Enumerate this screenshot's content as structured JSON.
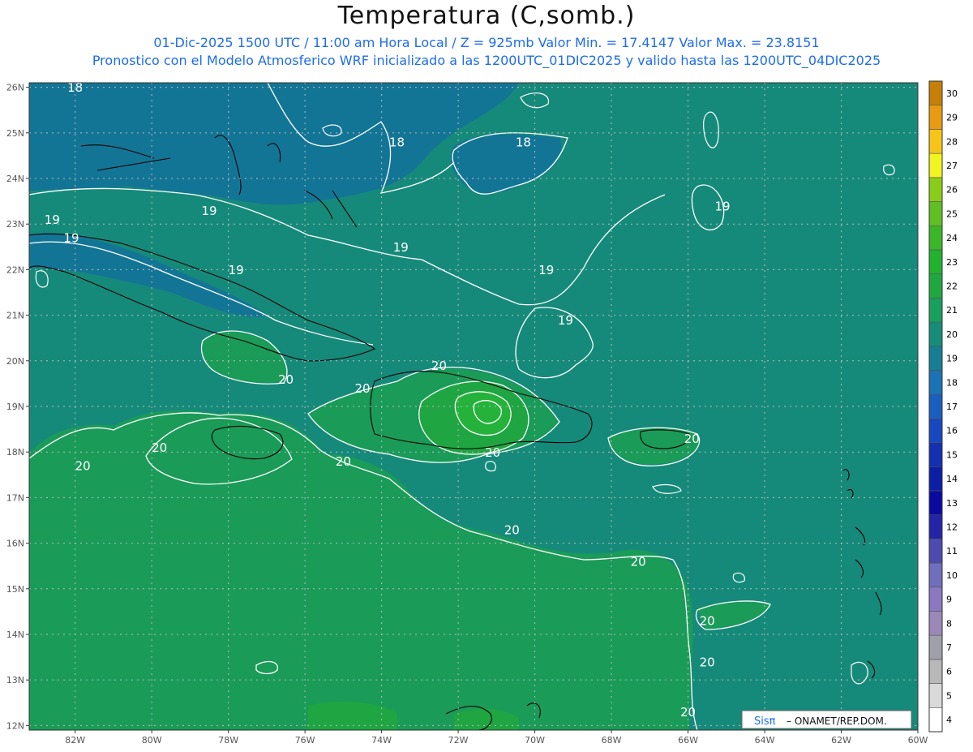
{
  "header": {
    "title": "Temperatura (C,somb.)",
    "line1": "01-Dic-2025  1500 UTC / 11:00 am Hora Local / Z = 925mb   Valor Min. = 17.4147  Valor Max. = 23.8151",
    "line2": "Pronostico con el Modelo Atmosferico WRF inicializado a las 1200UTC_01DIC2025 y valido hasta las  1200UTC_04DIC2025"
  },
  "map": {
    "lon_range": [
      -83.2,
      -60
    ],
    "lat_range": [
      11.9,
      26.1
    ],
    "lon_ticks": [
      {
        "value": -82,
        "label": "82W"
      },
      {
        "value": -80,
        "label": "80W"
      },
      {
        "value": -78,
        "label": "78W"
      },
      {
        "value": -76,
        "label": "76W"
      },
      {
        "value": -74,
        "label": "74W"
      },
      {
        "value": -72,
        "label": "72W"
      },
      {
        "value": -70,
        "label": "70W"
      },
      {
        "value": -68,
        "label": "68W"
      },
      {
        "value": -66,
        "label": "66W"
      },
      {
        "value": -64,
        "label": "64W"
      },
      {
        "value": -62,
        "label": "62W"
      },
      {
        "value": -60,
        "label": "60W"
      }
    ],
    "lat_ticks": [
      {
        "value": 26,
        "label": "26N"
      },
      {
        "value": 25,
        "label": "25N"
      },
      {
        "value": 24,
        "label": "24N"
      },
      {
        "value": 23,
        "label": "23N"
      },
      {
        "value": 22,
        "label": "22N"
      },
      {
        "value": 21,
        "label": "21N"
      },
      {
        "value": 20,
        "label": "20N"
      },
      {
        "value": 19,
        "label": "19N"
      },
      {
        "value": 18,
        "label": "18N"
      },
      {
        "value": 17,
        "label": "17N"
      },
      {
        "value": 16,
        "label": "16N"
      },
      {
        "value": 15,
        "label": "15N"
      },
      {
        "value": 14,
        "label": "14N"
      },
      {
        "value": 13,
        "label": "13N"
      },
      {
        "value": 12,
        "label": "12N"
      }
    ],
    "fill_colors": {
      "t18": "#137596",
      "t19": "#168a7a",
      "t20": "#1a9b58",
      "t21": "#1fa542",
      "t22": "#25b23a"
    },
    "contour_labels": [
      {
        "text": "18",
        "lon": -82.0,
        "lat": 25.9
      },
      {
        "text": "18",
        "lon": -73.6,
        "lat": 24.7
      },
      {
        "text": "18",
        "lon": -70.3,
        "lat": 24.7
      },
      {
        "text": "19",
        "lon": -78.5,
        "lat": 23.2
      },
      {
        "text": "19",
        "lon": -82.6,
        "lat": 23.0
      },
      {
        "text": "19",
        "lon": -82.1,
        "lat": 22.6
      },
      {
        "text": "19",
        "lon": -73.5,
        "lat": 22.4
      },
      {
        "text": "19",
        "lon": -77.8,
        "lat": 21.9
      },
      {
        "text": "19",
        "lon": -69.7,
        "lat": 21.9
      },
      {
        "text": "19",
        "lon": -65.1,
        "lat": 23.3
      },
      {
        "text": "19",
        "lon": -69.2,
        "lat": 20.8
      },
      {
        "text": "20",
        "lon": -76.5,
        "lat": 19.5
      },
      {
        "text": "20",
        "lon": -74.5,
        "lat": 19.3
      },
      {
        "text": "20",
        "lon": -72.5,
        "lat": 19.8
      },
      {
        "text": "20",
        "lon": -79.8,
        "lat": 18.0
      },
      {
        "text": "20",
        "lon": -81.8,
        "lat": 17.6
      },
      {
        "text": "20",
        "lon": -75.0,
        "lat": 17.7
      },
      {
        "text": "20",
        "lon": -71.1,
        "lat": 17.9
      },
      {
        "text": "20",
        "lon": -65.9,
        "lat": 18.2
      },
      {
        "text": "20",
        "lon": -70.6,
        "lat": 16.2
      },
      {
        "text": "20",
        "lon": -67.3,
        "lat": 15.5
      },
      {
        "text": "20",
        "lon": -65.5,
        "lat": 14.2
      },
      {
        "text": "20",
        "lon": -65.5,
        "lat": 13.3
      },
      {
        "text": "20",
        "lon": -66.0,
        "lat": 12.2
      }
    ]
  },
  "colorbar": {
    "labels": [
      "4",
      "5",
      "6",
      "7",
      "8",
      "9",
      "10",
      "11",
      "12",
      "13",
      "14",
      "15",
      "16",
      "17",
      "18",
      "19",
      "20",
      "21",
      "22",
      "23",
      "24",
      "25",
      "26",
      "27",
      "28",
      "29",
      "30"
    ],
    "colors": [
      "#ffffff",
      "#d9d9d9",
      "#b8b8b8",
      "#a0a0aa",
      "#9b88b8",
      "#8a78c0",
      "#6f6fbe",
      "#4b4bb0",
      "#2424a8",
      "#0a0aa0",
      "#0c1ea6",
      "#1230b0",
      "#1848c0",
      "#1a5fc0",
      "#1b73b4",
      "#177f93",
      "#168c7a",
      "#19a05c",
      "#1fa842",
      "#22b230",
      "#3db52a",
      "#5fbf24",
      "#8acc1a",
      "#f2f520",
      "#f7c41a",
      "#e89b10",
      "#c68008"
    ]
  },
  "credit": {
    "brand": "Sisπ",
    "agency": "– ONAMET/REP.DOM."
  }
}
